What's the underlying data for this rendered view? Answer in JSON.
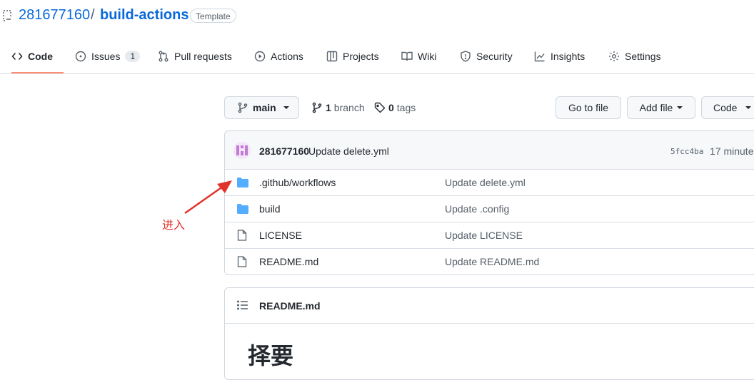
{
  "repo": {
    "owner": "281677160",
    "separator": "/",
    "name": "build-actions",
    "badge": "Template"
  },
  "nav": {
    "tabs": [
      {
        "label": "Code",
        "icon": "code-icon",
        "active": true
      },
      {
        "label": "Issues",
        "icon": "issue-icon",
        "count": "1"
      },
      {
        "label": "Pull requests",
        "icon": "pull-request-icon"
      },
      {
        "label": "Actions",
        "icon": "play-icon"
      },
      {
        "label": "Projects",
        "icon": "table-icon"
      },
      {
        "label": "Wiki",
        "icon": "book-icon"
      },
      {
        "label": "Security",
        "icon": "shield-icon"
      },
      {
        "label": "Insights",
        "icon": "graph-icon"
      },
      {
        "label": "Settings",
        "icon": "gear-icon"
      }
    ]
  },
  "branch_bar": {
    "branch": "main",
    "branches_count": "1",
    "branches_label": "branch",
    "tags_count": "0",
    "tags_label": "tags",
    "go_to_file": "Go to file",
    "add_file": "Add file",
    "code": "Code"
  },
  "latest_commit": {
    "author": "281677160",
    "message": "Update delete.yml",
    "sha": "5fcc4ba",
    "time": "17 minute"
  },
  "files": [
    {
      "name": ".github/workflows",
      "type": "folder",
      "message": "Update delete.yml"
    },
    {
      "name": "build",
      "type": "folder",
      "message": "Update .config"
    },
    {
      "name": "LICENSE",
      "type": "file",
      "message": "Update LICENSE"
    },
    {
      "name": "README.md",
      "type": "file",
      "message": "Update README.md"
    }
  ],
  "readme": {
    "filename": "README.md",
    "heading": "择要"
  },
  "annotation": {
    "text": "进入",
    "color": "#e0322b"
  },
  "colors": {
    "link": "#0969da",
    "active_tab_underline": "#fd8c73",
    "folder": "#54aeff"
  }
}
